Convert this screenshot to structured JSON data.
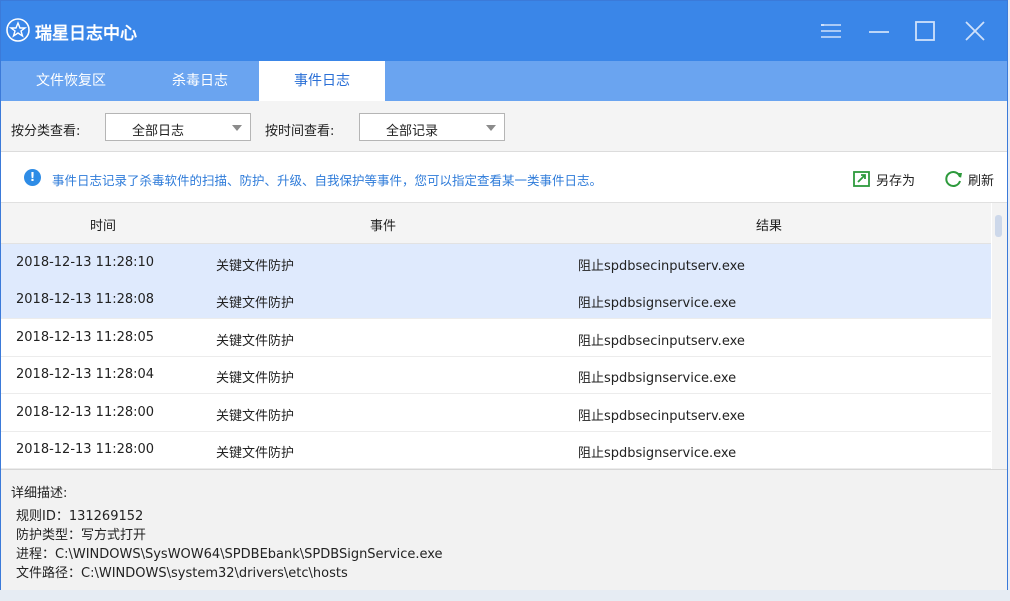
{
  "window": {
    "title": "瑞星日志中心",
    "controls": [
      "menu-icon",
      "minimize-icon",
      "maximize-icon",
      "close-icon"
    ]
  },
  "tabs": [
    {
      "label": "文件恢复区",
      "active": false
    },
    {
      "label": "杀毒日志",
      "active": false
    },
    {
      "label": "事件日志",
      "active": true
    }
  ],
  "filters": {
    "category_label": "按分类查看:",
    "category_value": "全部日志",
    "time_label": "按时间查看:",
    "time_value": "全部记录"
  },
  "info": {
    "text": "事件日志记录了杀毒软件的扫描、防护、升级、自我保护等事件，您可以指定查看某一类事件日志。",
    "save_as": "另存为",
    "refresh": "刷新"
  },
  "table": {
    "columns": [
      "时间",
      "事件",
      "结果"
    ],
    "rows": [
      {
        "time": "2018-12-13 11:28:10",
        "event": "关键文件防护",
        "result": "阻止spdbsecinputserv.exe",
        "selected": true
      },
      {
        "time": "2018-12-13 11:28:08",
        "event": "关键文件防护",
        "result": "阻止spdbsignservice.exe",
        "selected": true
      },
      {
        "time": "2018-12-13 11:28:05",
        "event": "关键文件防护",
        "result": "阻止spdbsecinputserv.exe",
        "selected": false
      },
      {
        "time": "2018-12-13 11:28:04",
        "event": "关键文件防护",
        "result": "阻止spdbsignservice.exe",
        "selected": false
      },
      {
        "time": "2018-12-13 11:28:00",
        "event": "关键文件防护",
        "result": "阻止spdbsecinputserv.exe",
        "selected": false
      },
      {
        "time": "2018-12-13 11:28:00",
        "event": "关键文件防护",
        "result": "阻止spdbsignservice.exe",
        "selected": false
      }
    ]
  },
  "detail": {
    "title": "详细描述:",
    "lines": [
      "规则ID：131269152",
      "防护类型：写方式打开",
      "进程：C:\\WINDOWS\\SysWOW64\\SPDBEbank\\SPDBSignService.exe",
      "文件路径：C:\\WINDOWS\\system32\\drivers\\etc\\hosts"
    ]
  },
  "colors": {
    "titlebar": "#3a86e8",
    "tabbar": "#6aa4f0",
    "accent": "#2e7bd9",
    "selected_row": "#dfeafd"
  }
}
